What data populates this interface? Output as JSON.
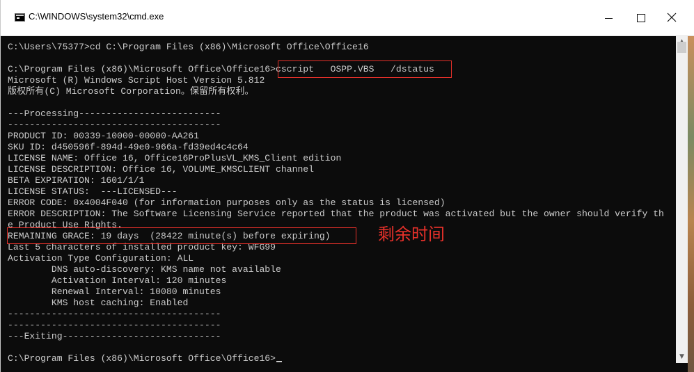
{
  "window": {
    "title": "C:\\WINDOWS\\system32\\cmd.exe",
    "icon": "cmd-icon"
  },
  "controls": {
    "minimize": "minimize-icon",
    "maximize": "maximize-icon",
    "close": "close-icon"
  },
  "console": {
    "lines": [
      "C:\\Users\\75377>cd C:\\Program Files (x86)\\Microsoft Office\\Office16",
      "",
      "C:\\Program Files (x86)\\Microsoft Office\\Office16>cscript   OSPP.VBS   /dstatus",
      "Microsoft (R) Windows Script Host Version 5.812",
      "版权所有(C) Microsoft Corporation。保留所有权利。",
      "",
      "---Processing--------------------------",
      "---------------------------------------",
      "PRODUCT ID: 00339-10000-00000-AA261",
      "SKU ID: d450596f-894d-49e0-966a-fd39ed4c4c64",
      "LICENSE NAME: Office 16, Office16ProPlusVL_KMS_Client edition",
      "LICENSE DESCRIPTION: Office 16, VOLUME_KMSCLIENT channel",
      "BETA EXPIRATION: 1601/1/1",
      "LICENSE STATUS:  ---LICENSED---",
      "ERROR CODE: 0x4004F040 (for information purposes only as the status is licensed)",
      "ERROR DESCRIPTION: The Software Licensing Service reported that the product was activated but the owner should verify th",
      "e Product Use Rights.",
      "REMAINING GRACE: 19 days  (28422 minute(s) before expiring)",
      "Last 5 characters of installed product key: WFG99",
      "Activation Type Configuration: ALL",
      "        DNS auto-discovery: KMS name not available",
      "        Activation Interval: 120 minutes",
      "        Renewal Interval: 10080 minutes",
      "        KMS host caching: Enabled",
      "---------------------------------------",
      "---------------------------------------",
      "---Exiting-----------------------------",
      "",
      "C:\\Program Files (x86)\\Microsoft Office\\Office16>"
    ]
  },
  "annotation": {
    "text": "剩余时间",
    "color": "#e8312a"
  },
  "colors": {
    "console_bg": "#0c0c0c",
    "console_text": "#cccccc",
    "highlight_red": "#e8312a"
  }
}
